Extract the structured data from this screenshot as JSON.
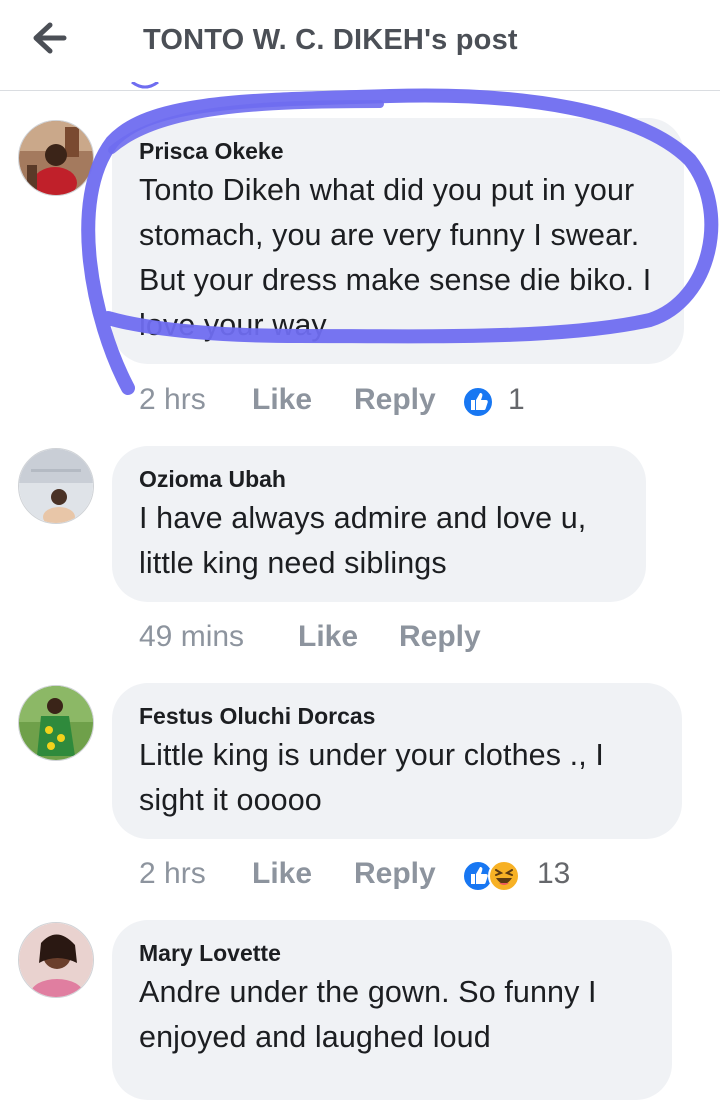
{
  "header": {
    "back_icon": "arrow-left-icon",
    "title": "TONTO W. C. DIKEH's post"
  },
  "colors": {
    "like_blue": "#1877f2",
    "haha_yellow": "#f7b125",
    "meta_gray": "#8d949e",
    "bubble_bg": "#f0f2f5",
    "highlight_purple": "#6f6df0"
  },
  "comments": [
    {
      "author": "Prisca Okeke",
      "text": "Tonto Dikeh what did you put in your stomach, you are very funny I swear. But your dress make sense die biko. I love your way",
      "time": "2 hrs",
      "like_label": "Like",
      "reply_label": "Reply",
      "reactions": [
        "like"
      ],
      "reaction_count": "1"
    },
    {
      "author": "Ozioma Ubah",
      "text": "I have always admire and love u, little king need siblings",
      "time": "49 mins",
      "like_label": "Like",
      "reply_label": "Reply"
    },
    {
      "author": "Festus Oluchi Dorcas",
      "text": "Little king is under  your clothes ., I sight it ooooo",
      "time": "2 hrs",
      "like_label": "Like",
      "reply_label": "Reply",
      "reactions": [
        "like",
        "haha"
      ],
      "reaction_count": "13"
    },
    {
      "author": "Mary Lovette",
      "text": "Andre under the gown. So funny  I enjoyed and laughed loud"
    }
  ]
}
